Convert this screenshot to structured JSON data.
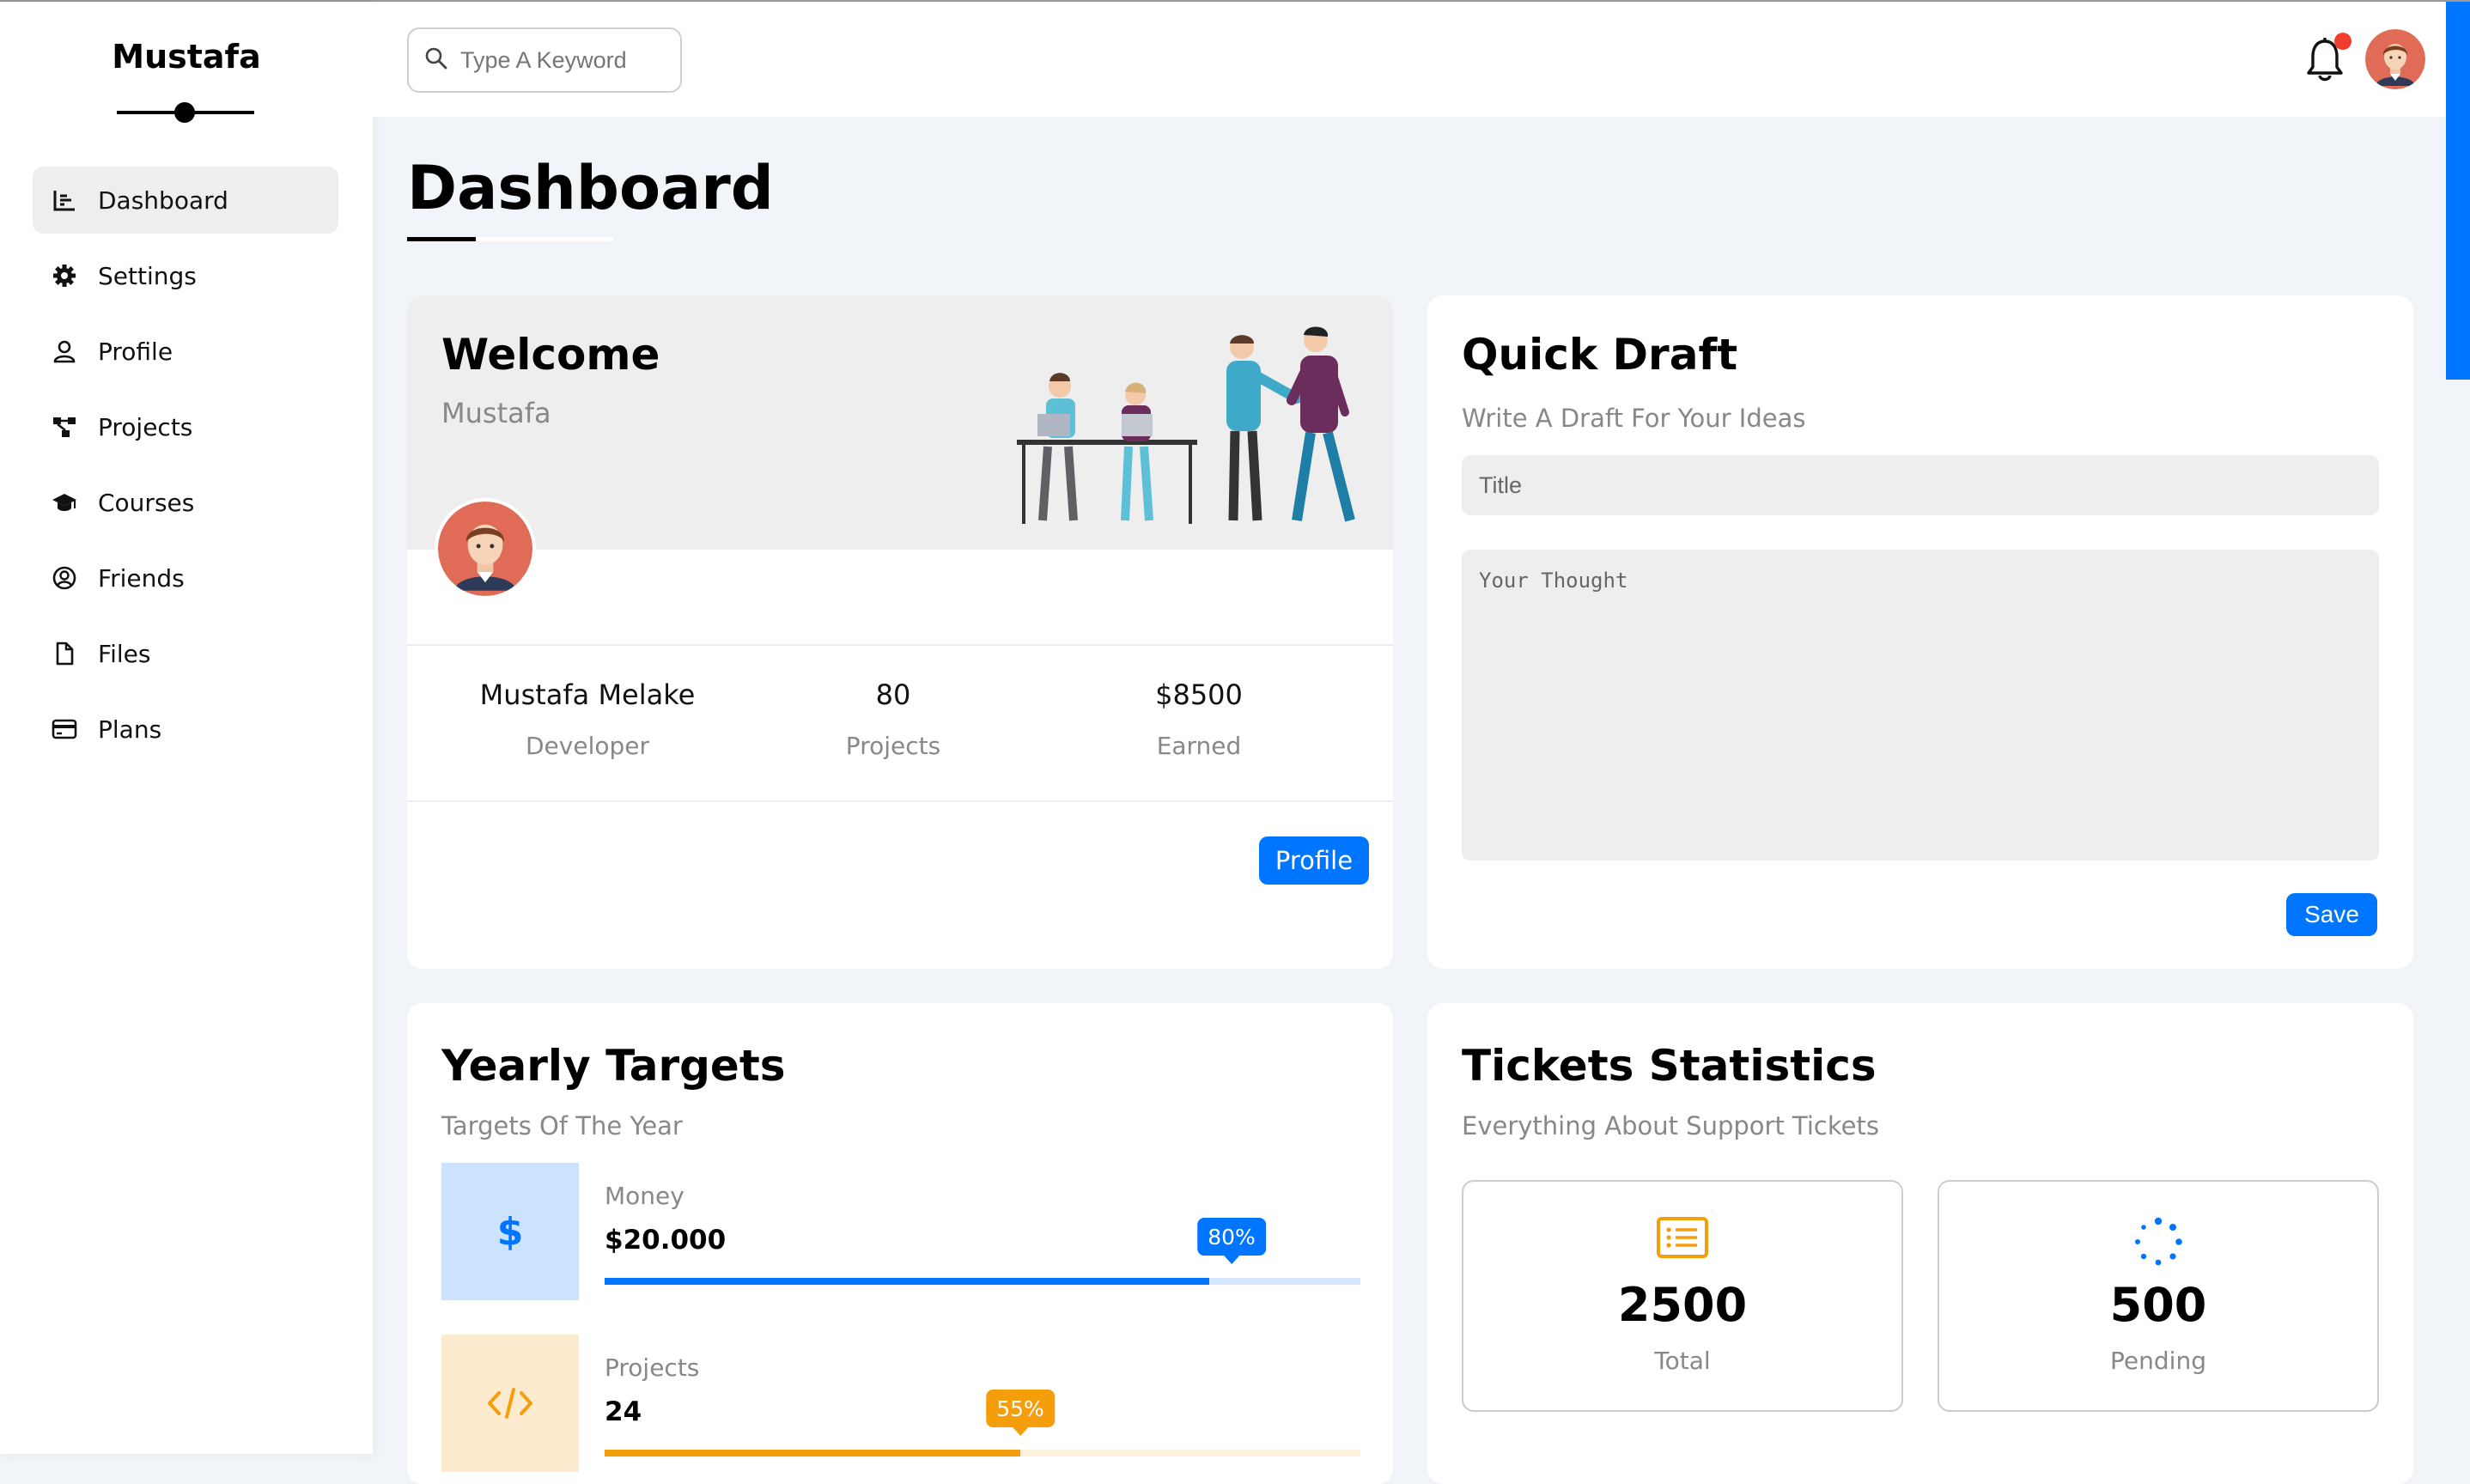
{
  "brand": "Mustafa",
  "sidebar": {
    "items": [
      {
        "label": "Dashboard",
        "icon": "chart-icon",
        "active": true
      },
      {
        "label": "Settings",
        "icon": "gear-icon"
      },
      {
        "label": "Profile",
        "icon": "user-icon"
      },
      {
        "label": "Projects",
        "icon": "diagram-icon"
      },
      {
        "label": "Courses",
        "icon": "graduation-cap-icon"
      },
      {
        "label": "Friends",
        "icon": "user-circle-icon"
      },
      {
        "label": "Files",
        "icon": "file-icon"
      },
      {
        "label": "Plans",
        "icon": "credit-card-icon"
      }
    ]
  },
  "topbar": {
    "search_placeholder": "Type A Keyword",
    "notification_icon": "bell-icon"
  },
  "page": {
    "title": "Dashboard"
  },
  "welcome": {
    "title": "Welcome",
    "subtitle": "Mustafa",
    "stats": [
      {
        "value": "Mustafa Melake",
        "label": "Developer"
      },
      {
        "value": "80",
        "label": "Projects"
      },
      {
        "value": "$8500",
        "label": "Earned"
      }
    ],
    "button": "Profile"
  },
  "draft": {
    "title": "Quick Draft",
    "subtitle": "Write A Draft For Your Ideas",
    "title_placeholder": "Title",
    "thought_placeholder": "Your Thought",
    "button": "Save"
  },
  "targets": {
    "title": "Yearly Targets",
    "subtitle": "Targets Of The Year",
    "items": [
      {
        "label": "Money",
        "value": "$20.000",
        "percent": 80,
        "badge": "80%",
        "icon": "dollar-icon",
        "color": "#0075ff",
        "bg": "#cce3ff",
        "track": "#d6e8ff"
      },
      {
        "label": "Projects",
        "value": "24",
        "percent": 55,
        "badge": "55%",
        "icon": "code-icon",
        "color": "#f59e0b",
        "bg": "#fdebd0",
        "track": "#fdf0dc"
      }
    ]
  },
  "tickets": {
    "title": "Tickets Statistics",
    "subtitle": "Everything About Support Tickets",
    "boxes": [
      {
        "value": "2500",
        "label": "Total",
        "icon": "list-icon",
        "color": "#f59e0b"
      },
      {
        "value": "500",
        "label": "Pending",
        "icon": "spinner-icon",
        "color": "#0075ff"
      }
    ]
  },
  "colors": {
    "accent": "#0075ff",
    "orange": "#f59e0b",
    "notification": "#ef3d2e"
  }
}
